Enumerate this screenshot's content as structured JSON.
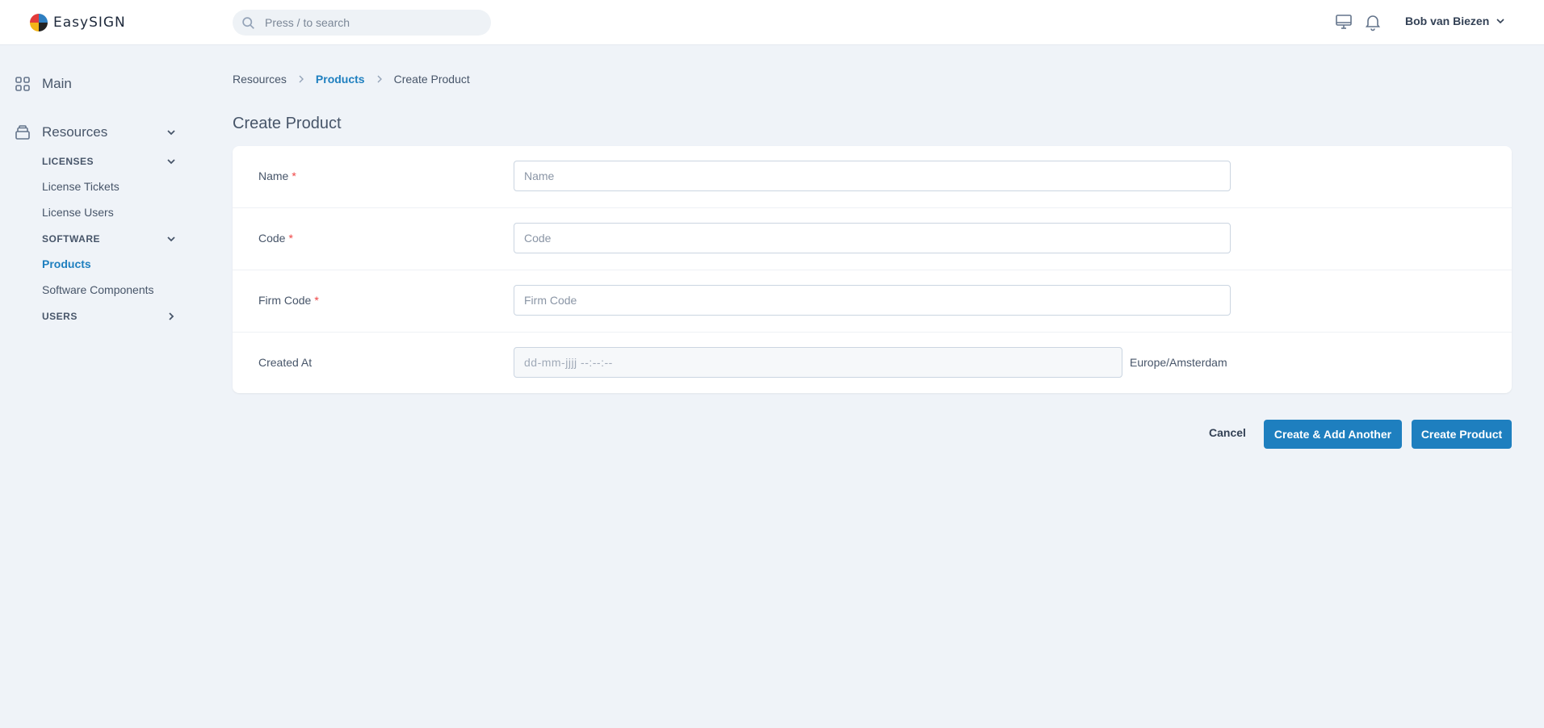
{
  "app": {
    "logo_text": "EasySIGN"
  },
  "search": {
    "placeholder": "Press / to search"
  },
  "header": {
    "user_name": "Bob van Biezen"
  },
  "sidebar": {
    "main_label": "Main",
    "resources_label": "Resources",
    "licenses_label": "LICENSES",
    "license_tickets_label": "License Tickets",
    "license_users_label": "License Users",
    "software_label": "SOFTWARE",
    "products_label": "Products",
    "software_components_label": "Software Components",
    "users_label": "USERS"
  },
  "breadcrumb": {
    "resources": "Resources",
    "products": "Products",
    "current": "Create Product"
  },
  "page": {
    "title": "Create Product"
  },
  "form": {
    "required_marker": "*",
    "name": {
      "label": "Name",
      "placeholder": "Name"
    },
    "code": {
      "label": "Code",
      "placeholder": "Code"
    },
    "firm_code": {
      "label": "Firm Code",
      "placeholder": "Firm Code"
    },
    "created_at": {
      "label": "Created At",
      "placeholder": "dd-mm-jjjj --:--:--",
      "timezone": "Europe/Amsterdam"
    }
  },
  "actions": {
    "cancel": "Cancel",
    "create_add_another": "Create & Add Another",
    "create": "Create Product"
  },
  "colors": {
    "accent": "#1e7fbf",
    "required": "#ef4444",
    "background": "#eff3f8"
  }
}
